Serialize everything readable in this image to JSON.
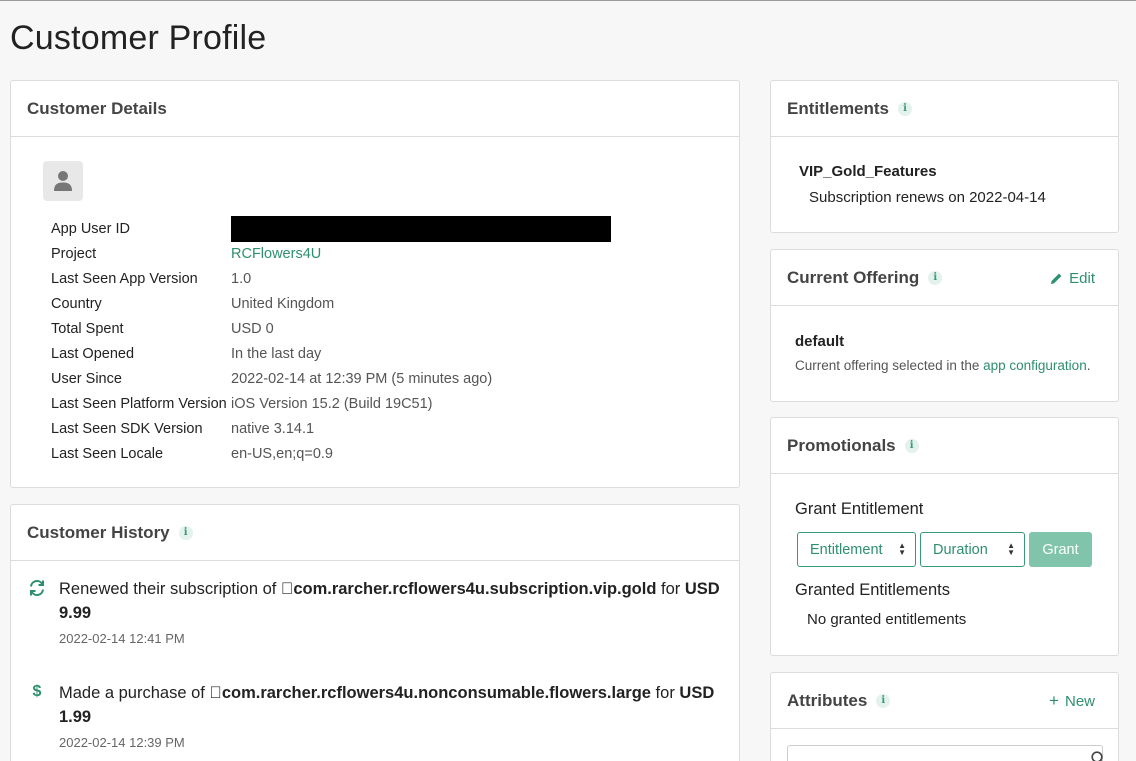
{
  "page": {
    "title": "Customer Profile"
  },
  "details": {
    "title": "Customer Details",
    "rows": [
      {
        "key": "App User ID",
        "value": ""
      },
      {
        "key": "Project",
        "value": "RCFlowers4U"
      },
      {
        "key": "Last Seen App Version",
        "value": "1.0"
      },
      {
        "key": "Country",
        "value": "United Kingdom"
      },
      {
        "key": "Total Spent",
        "value": "USD 0"
      },
      {
        "key": "Last Opened",
        "value": "In the last day"
      },
      {
        "key": "User Since",
        "value": "2022-02-14 at 12:39 PM (5 minutes ago)"
      },
      {
        "key": "Last Seen Platform Version",
        "value": "iOS Version 15.2 (Build 19C51)"
      },
      {
        "key": "Last Seen SDK Version",
        "value": "native 3.14.1"
      },
      {
        "key": "Last Seen Locale",
        "value": "en-US,en;q=0.9"
      }
    ]
  },
  "history": {
    "title": "Customer History",
    "items": [
      {
        "icon": "refresh-icon",
        "prefix": "Renewed their subscription of ",
        "product": "com.rarcher.rcflowers4u.subscription.vip.gold",
        "mid": " for ",
        "amount": "USD 9.99",
        "time": "2022-02-14 12:41 PM"
      },
      {
        "icon": "dollar-icon",
        "prefix": "Made a purchase of ",
        "product": "com.rarcher.rcflowers4u.nonconsumable.flowers.large",
        "mid": " for ",
        "amount": "USD 1.99",
        "time": "2022-02-14 12:39 PM"
      }
    ]
  },
  "entitlements": {
    "title": "Entitlements",
    "name": "VIP_Gold_Features",
    "subtitle": "Subscription renews on 2022-04-14"
  },
  "offering": {
    "title": "Current Offering",
    "edit_label": "Edit",
    "name": "default",
    "desc_prefix": "Current offering selected in the ",
    "desc_link": "app configuration",
    "desc_suffix": "."
  },
  "promotionals": {
    "title": "Promotionals",
    "grant_title": "Grant Entitlement",
    "entitlement_select": "Entitlement",
    "duration_select": "Duration",
    "grant_label": "Grant",
    "granted_title": "Granted Entitlements",
    "granted_empty": "No granted entitlements"
  },
  "attributes": {
    "title": "Attributes",
    "new_label": "New",
    "search_placeholder": "Search"
  },
  "colors": {
    "accent": "#2e8f6f",
    "grant_button": "#7fc4ab"
  }
}
